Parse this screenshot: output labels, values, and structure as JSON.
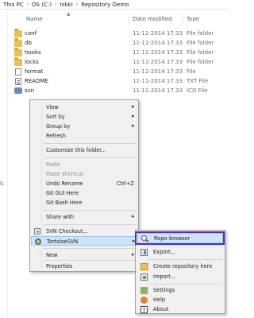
{
  "breadcrumb": [
    "This PC",
    "OS (C:)",
    "nikki",
    "Repository Demo"
  ],
  "columns": {
    "name": "Name",
    "date": "Date modified",
    "type": "Type"
  },
  "nav_stub": "5.",
  "files": [
    {
      "name": "conf",
      "date": "11-11-2014 17:33",
      "type": "File folder",
      "icon": "folder-icon"
    },
    {
      "name": "db",
      "date": "11-11-2014 17:33",
      "type": "File folder",
      "icon": "folder-icon"
    },
    {
      "name": "hooks",
      "date": "11-11-2014 17:33",
      "type": "File folder",
      "icon": "folder-icon"
    },
    {
      "name": "locks",
      "date": "11-11-2014 17:33",
      "type": "File folder",
      "icon": "folder-icon"
    },
    {
      "name": "format",
      "date": "11-11-2014 17:33",
      "type": "File",
      "icon": "file-icon"
    },
    {
      "name": "README",
      "date": "11-11-2014 17:33",
      "type": "TXT File",
      "icon": "txt-icon"
    },
    {
      "name": "svn",
      "date": "11-11-2014 17:33",
      "type": "ICO File",
      "icon": "ico-icon"
    }
  ],
  "context_menu": {
    "view": "View",
    "sort_by": "Sort by",
    "group_by": "Group by",
    "refresh": "Refresh",
    "customize": "Customize this folder...",
    "paste": "Paste",
    "paste_shortcut": "Paste shortcut",
    "undo_rename": "Undo Rename",
    "undo_shortcut": "Ctrl+Z",
    "git_gui": "Git GUI Here",
    "git_bash": "Git Bash Here",
    "share_with": "Share with",
    "svn_checkout": "SVN Checkout...",
    "tortoisesvn": "TortoiseSVN",
    "new": "New",
    "properties": "Properties"
  },
  "submenu": {
    "repo_browser": "Repo-browser",
    "export": "Export...",
    "create_repo": "Create repository here",
    "import": "Import...",
    "settings": "Settings",
    "help": "Help",
    "about": "About"
  },
  "colors": {
    "highlight_border": "#5b2db0",
    "menu_bg": "#f0f0f0",
    "hover_bg": "#cde3f7"
  }
}
